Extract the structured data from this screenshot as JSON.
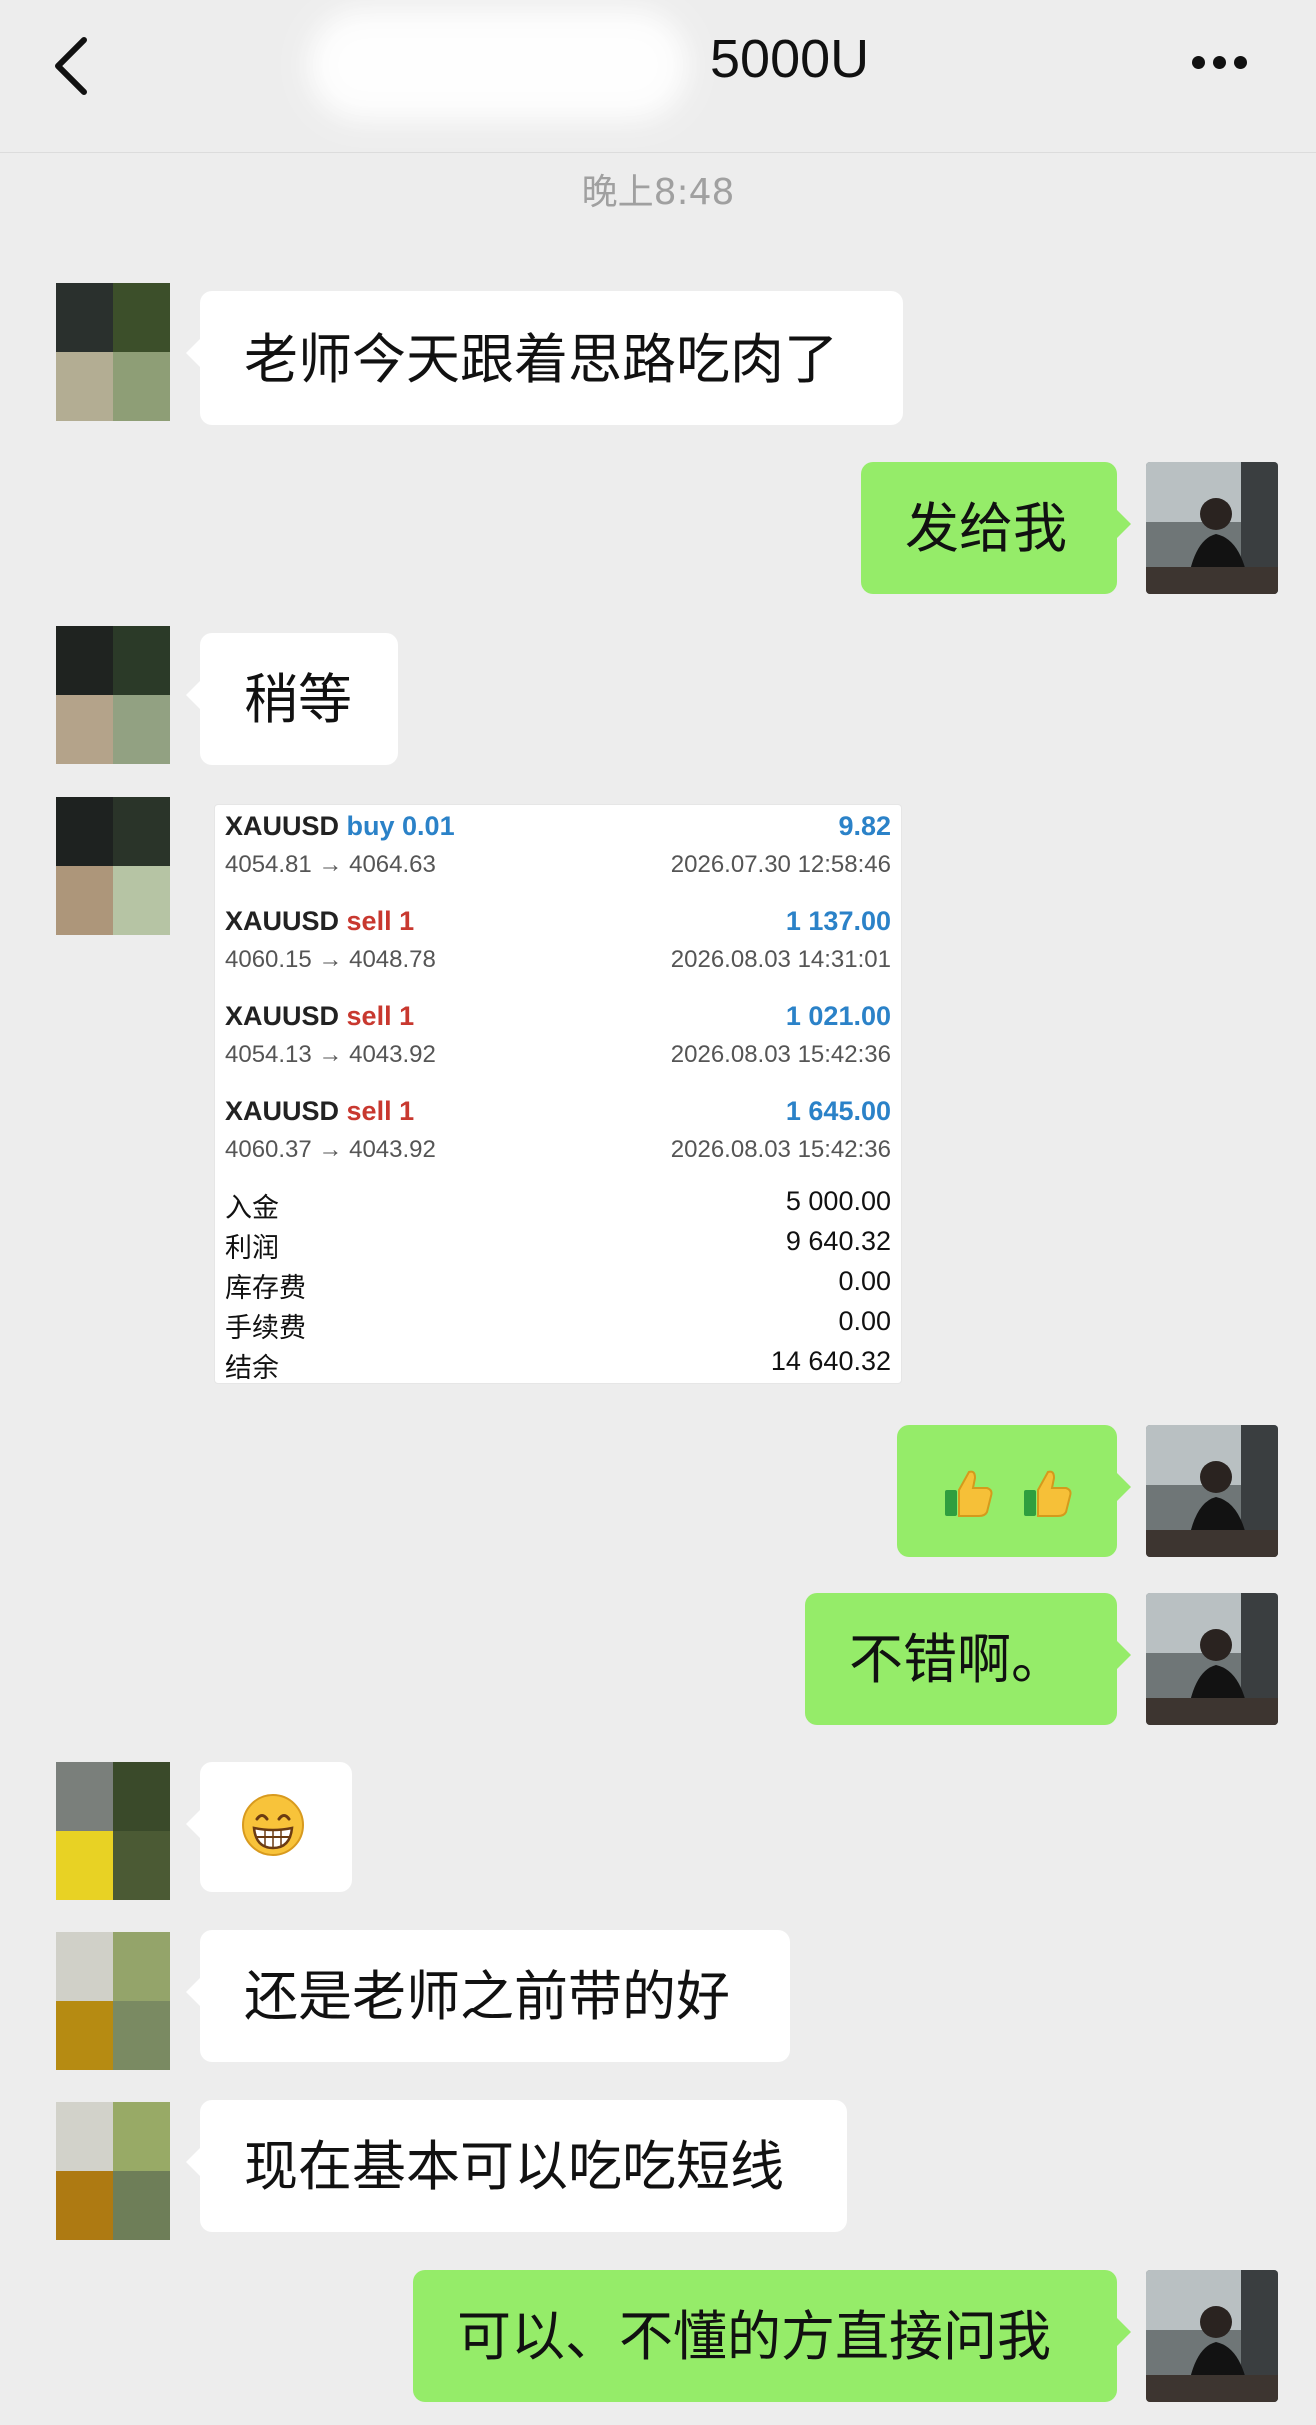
{
  "header": {
    "title": "5000U",
    "back_icon": "chevron-left-icon",
    "more_icon": "more-dots-icon"
  },
  "timestamp": "晚上8:48",
  "messages": [
    {
      "side": "left",
      "text": "老师今天跟着思路吃肉了"
    },
    {
      "side": "right",
      "text": "发给我"
    },
    {
      "side": "left",
      "text": "稍等"
    },
    {
      "side": "right",
      "text": "👍👍"
    },
    {
      "side": "right",
      "text": "不错啊。"
    },
    {
      "side": "left",
      "text": "😁"
    },
    {
      "side": "left",
      "text": "还是老师之前带的好"
    },
    {
      "side": "left",
      "text": "现在基本可以吃吃短线"
    },
    {
      "side": "right",
      "text": "可以、不懂的方直接问我"
    }
  ],
  "trade_image": {
    "trades": [
      {
        "symbol": "XAUUSD",
        "dir": "buy 0.01",
        "profit": "9.82",
        "prices": "4054.81 → 4064.63",
        "datetime": "2026.07.30 12:58:46"
      },
      {
        "symbol": "XAUUSD",
        "dir": "sell 1",
        "profit": "1 137.00",
        "prices": "4060.15 → 4048.78",
        "datetime": "2026.08.03 14:31:01"
      },
      {
        "symbol": "XAUUSD",
        "dir": "sell 1",
        "profit": "1 021.00",
        "prices": "4054.13 → 4043.92",
        "datetime": "2026.08.03 15:42:36"
      },
      {
        "symbol": "XAUUSD",
        "dir": "sell 1",
        "profit": "1 645.00",
        "prices": "4060.37 → 4043.92",
        "datetime": "2026.08.03 15:42:36"
      }
    ],
    "summary": [
      {
        "label": "入金",
        "value": "5 000.00"
      },
      {
        "label": "利润",
        "value": "9 640.32"
      },
      {
        "label": "库存费",
        "value": "0.00"
      },
      {
        "label": "手续费",
        "value": "0.00"
      },
      {
        "label": "结余",
        "value": "14 640.32"
      }
    ]
  },
  "colors": {
    "background": "#ededed",
    "my_bubble": "#95ec69",
    "their_bubble": "#ffffff",
    "buy": "#2b82c8",
    "sell": "#c8382f"
  }
}
